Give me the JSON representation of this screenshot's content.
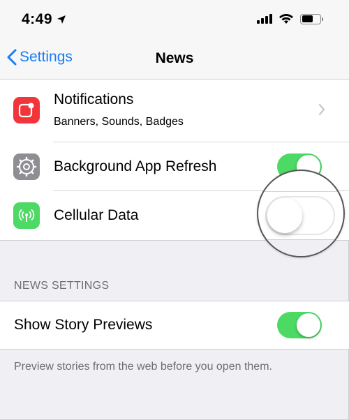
{
  "status_bar": {
    "time": "4:49",
    "icons": [
      "location-arrow-icon",
      "cellular-signal-icon",
      "wifi-icon",
      "battery-icon"
    ]
  },
  "nav": {
    "back_label": "Settings",
    "title": "News"
  },
  "rows": {
    "notifications": {
      "label": "Notifications",
      "sublabel": "Banners, Sounds, Badges",
      "icon": "notifications-icon",
      "icon_color": "#f2353a"
    },
    "background_refresh": {
      "label": "Background App Refresh",
      "icon": "gear-icon",
      "icon_color": "#8e8e93",
      "enabled": true
    },
    "cellular_data": {
      "label": "Cellular Data",
      "icon": "cellular-antenna-icon",
      "icon_color": "#4cd964",
      "enabled": false
    }
  },
  "news_settings": {
    "header": "NEWS SETTINGS",
    "show_story_previews": {
      "label": "Show Story Previews",
      "enabled": true
    },
    "footer": "Preview stories from the web before you open them."
  },
  "colors": {
    "accent": "#1a7cf5",
    "toggle_on": "#4cd964"
  }
}
